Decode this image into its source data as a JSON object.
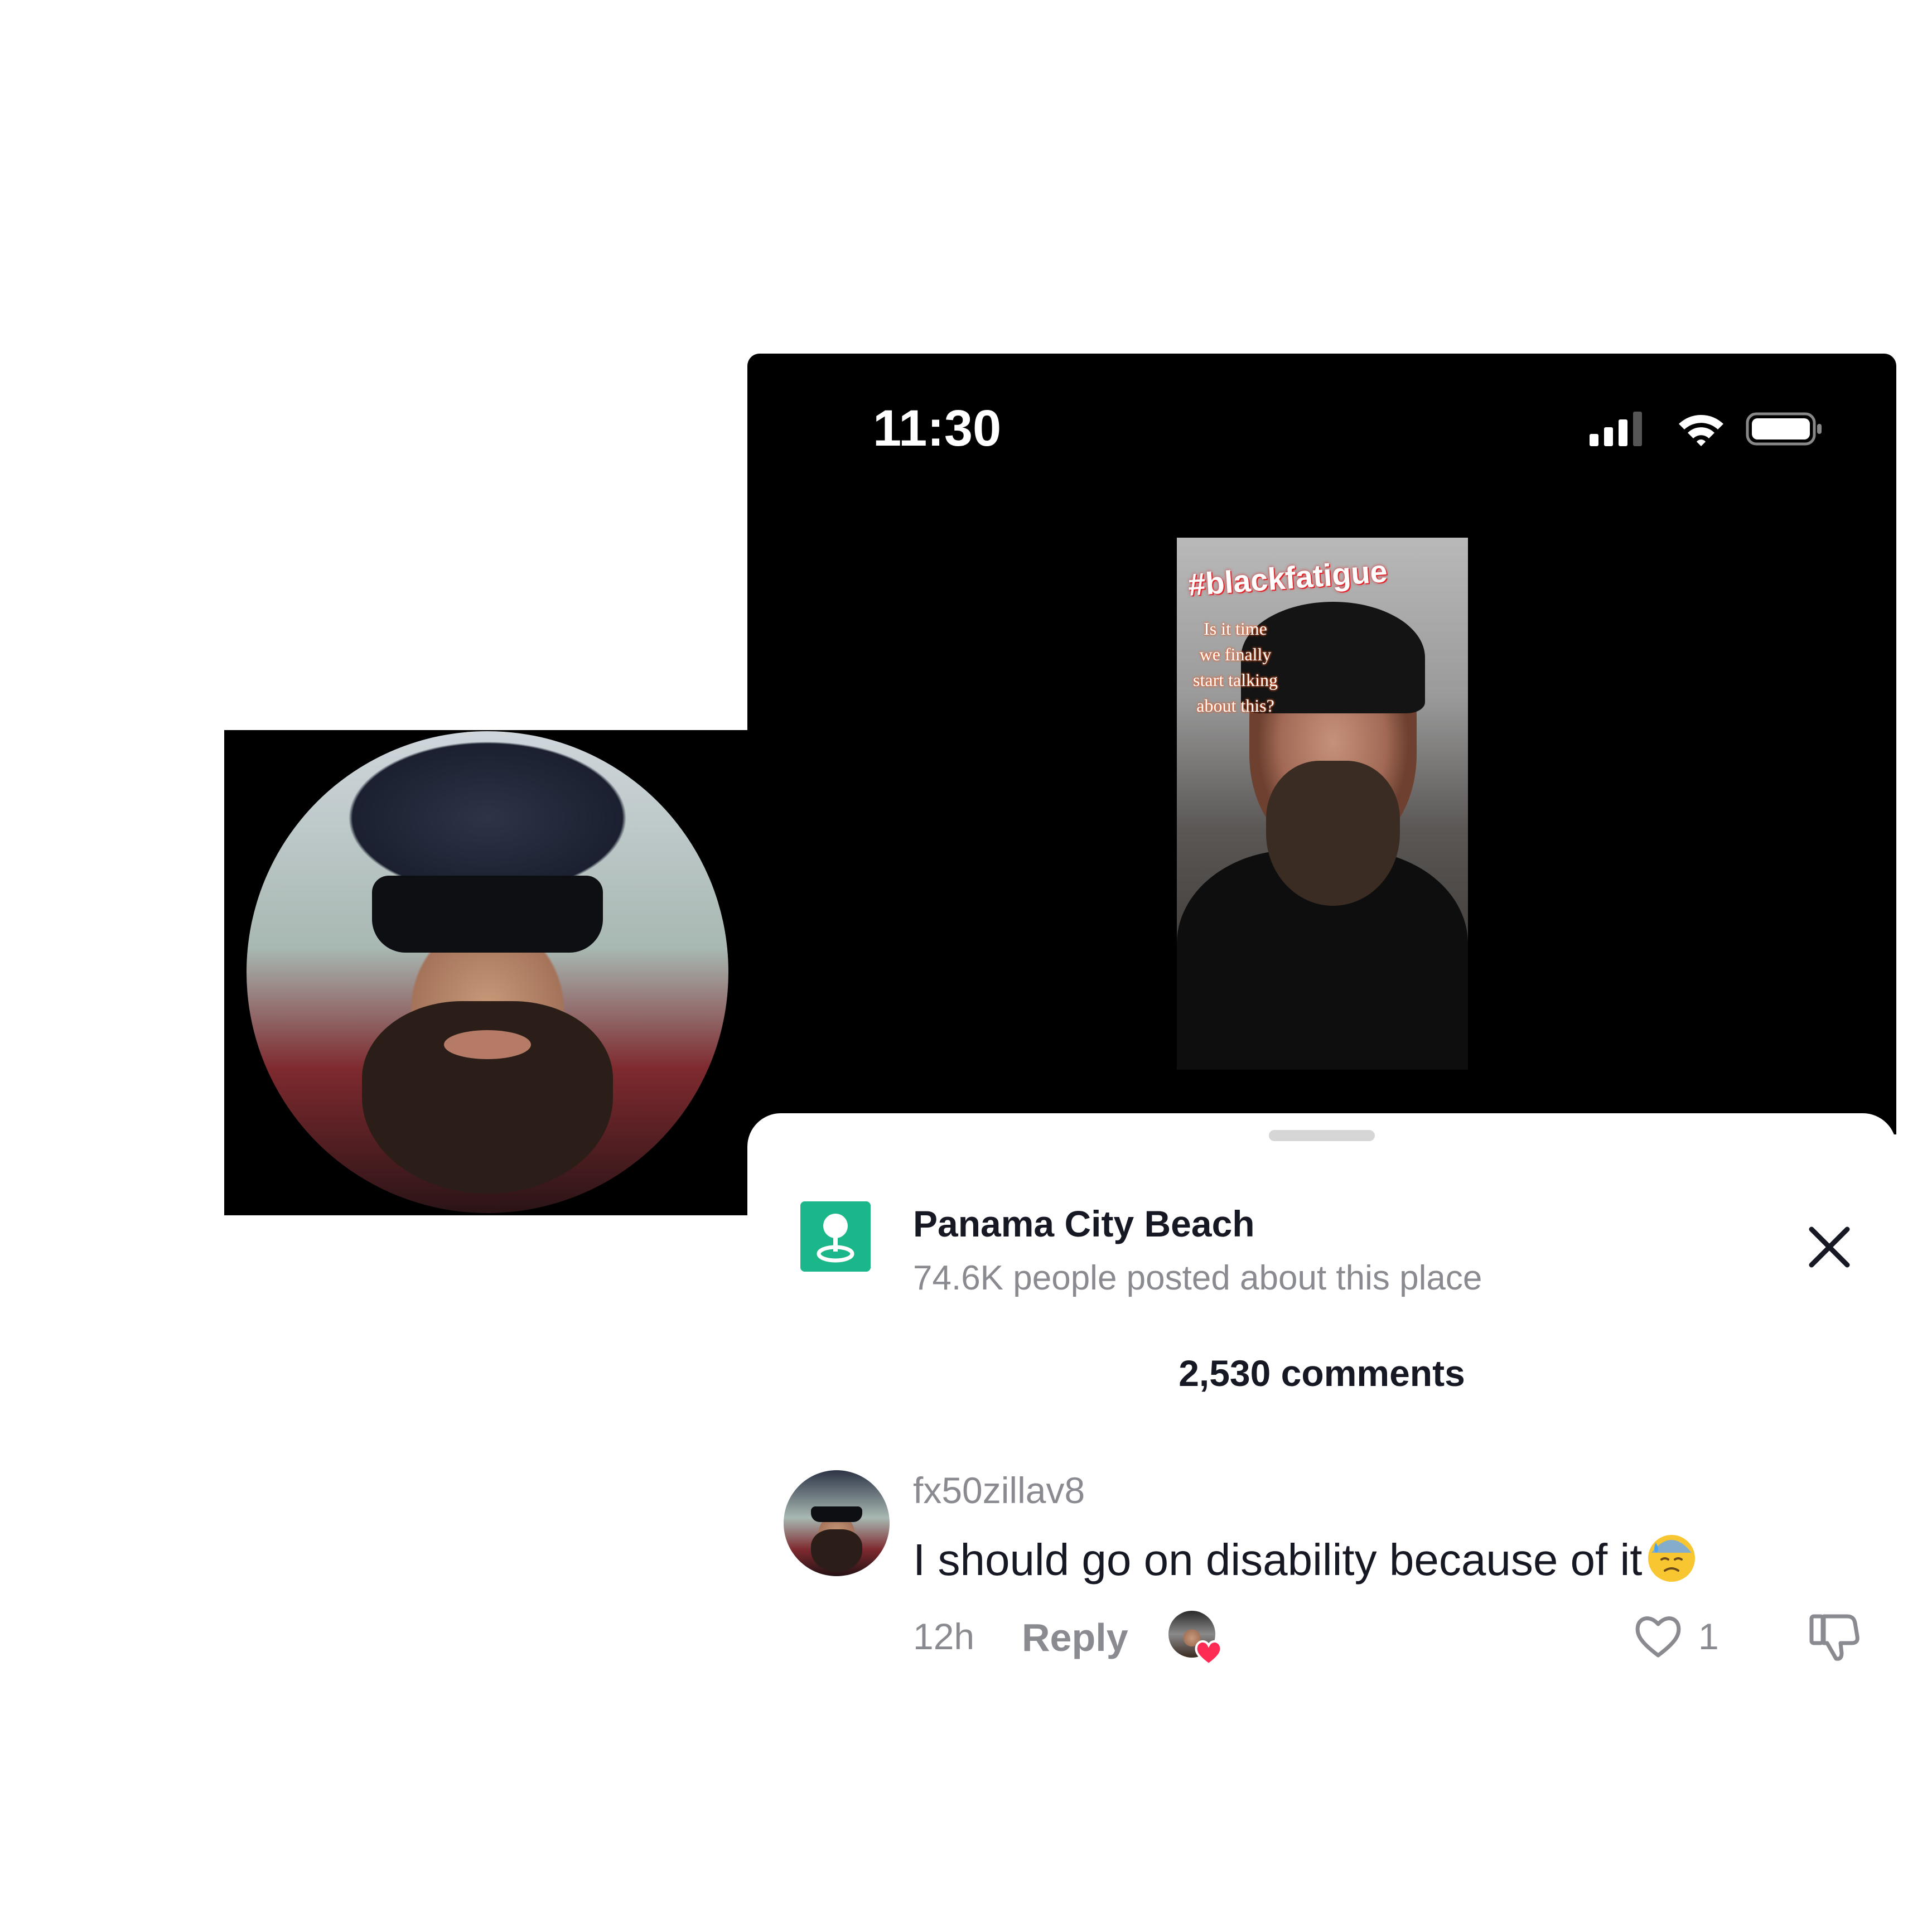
{
  "status_bar": {
    "time": "11:30",
    "icons": [
      "signal-icon",
      "wifi-icon",
      "battery-icon"
    ]
  },
  "video": {
    "hashtag": "#blackfatigue",
    "overlay_lines": [
      "Is it time",
      "we finally",
      "start talking",
      "about this?"
    ]
  },
  "place": {
    "icon": "location-pin-icon",
    "title": "Panama City Beach",
    "subtitle": "74.6K people posted about this place"
  },
  "comments": {
    "count_label": "2,530 comments",
    "items": [
      {
        "username": "fx50zillav8",
        "text": "I should go on disability because of it",
        "emoji": "sweat-face-emoji",
        "time": "12h",
        "reply_label": "Reply",
        "like_count": "1",
        "liked_by_creator": true
      }
    ]
  },
  "colors": {
    "place_icon_bg": "#1bb68a",
    "heart_red": "#fe2c55",
    "muted_text": "#8a8b91",
    "primary_text": "#161823"
  }
}
